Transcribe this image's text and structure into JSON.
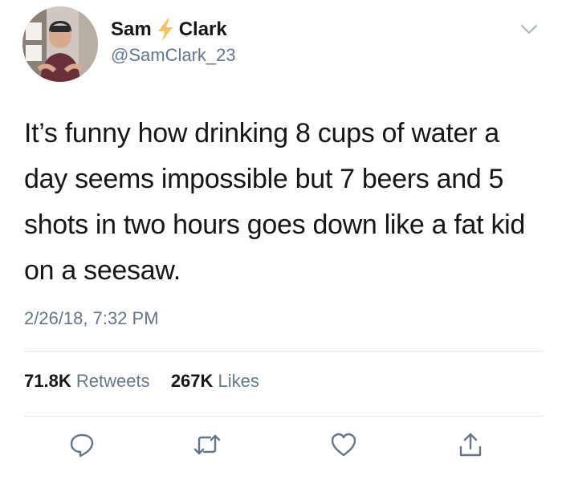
{
  "tweet": {
    "name_first": "Sam",
    "name_last": "Clark",
    "name_emoji": "lightning-bolt-icon",
    "handle": "@SamClark_23",
    "text": "It’s funny how drinking 8 cups of water a day seems impossible but 7 beers and 5 shots in two hours goes down like a fat kid on a seesaw.",
    "timestamp": "2/26/18, 7:32 PM",
    "retweets_count": "71.8K",
    "retweets_label": "Retweets",
    "likes_count": "267K",
    "likes_label": "Likes"
  },
  "icons": {
    "caret": "chevron-down-icon",
    "reply": "reply-icon",
    "retweet": "retweet-icon",
    "like": "heart-icon",
    "share": "share-icon"
  },
  "colors": {
    "text": "#14171a",
    "secondary": "#657786",
    "divider": "#e1e8ed",
    "bolt": "#f5c26b"
  }
}
